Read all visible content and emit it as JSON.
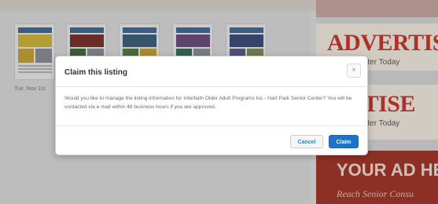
{
  "modal": {
    "title": "Claim this listing",
    "close_label": "×",
    "message": "Would you like to manage the listing information for Interfaith Older Adult Programs Inc - Hart Park Senior Center? You will be contacted via e-mail within 48 business hours if you are approved.",
    "buttons": {
      "cancel": "Cancel",
      "claim": "Claim"
    }
  },
  "background": {
    "thumbnail_caption": "Tue, Nov 1st",
    "ads": {
      "ad1_headline": "ADVERTISE",
      "ad1_sub": "enior Center Today",
      "ad2_headline": "ERTISE",
      "ad2_sub": "enior Center Today",
      "ad3_headline": "YOUR AD HER",
      "ad3_sub": "Reach Senior Consu"
    }
  },
  "colors": {
    "primary_button": "#1e73c8",
    "ad_red": "#c8352a"
  }
}
